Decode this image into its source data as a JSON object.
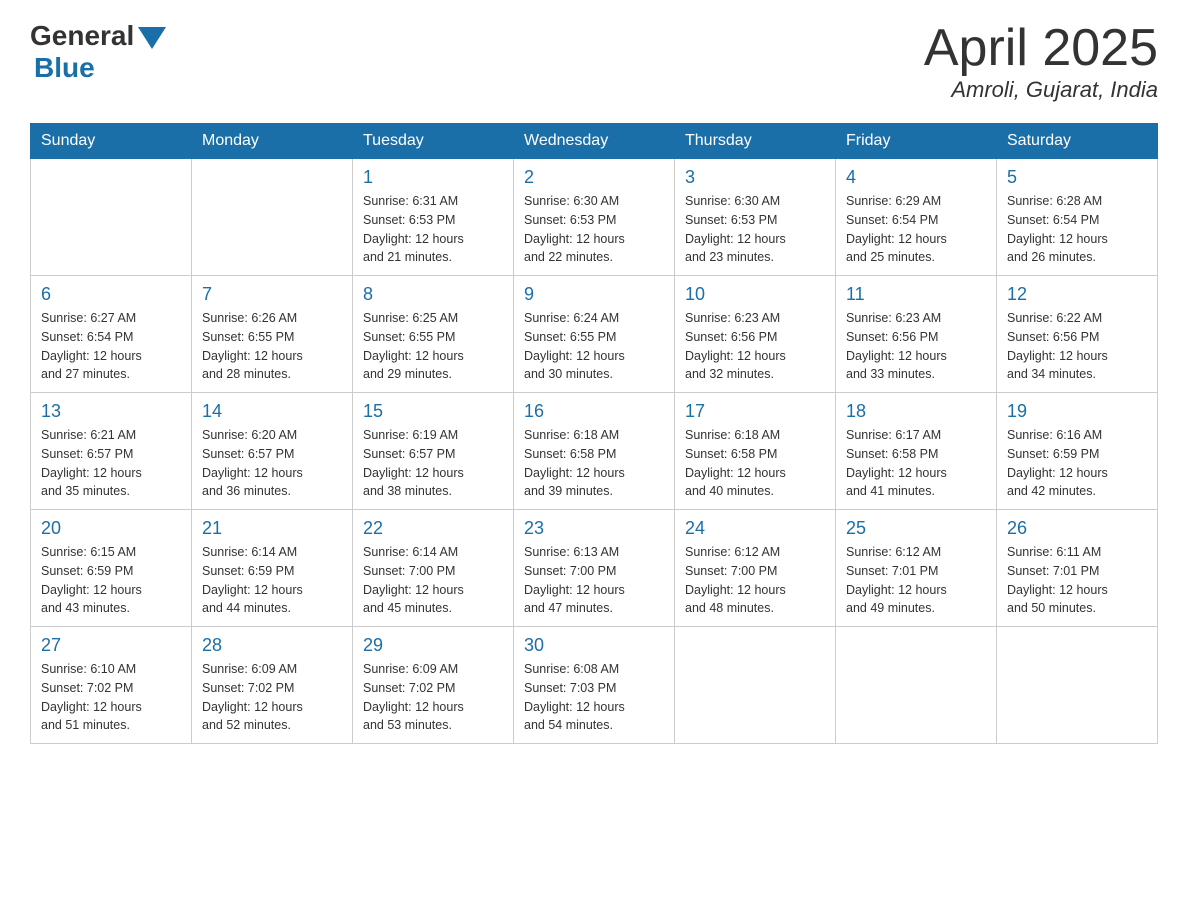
{
  "logo": {
    "general": "General",
    "blue": "Blue"
  },
  "title": "April 2025",
  "location": "Amroli, Gujarat, India",
  "days_of_week": [
    "Sunday",
    "Monday",
    "Tuesday",
    "Wednesday",
    "Thursday",
    "Friday",
    "Saturday"
  ],
  "weeks": [
    [
      {
        "day": "",
        "info": ""
      },
      {
        "day": "",
        "info": ""
      },
      {
        "day": "1",
        "info": "Sunrise: 6:31 AM\nSunset: 6:53 PM\nDaylight: 12 hours\nand 21 minutes."
      },
      {
        "day": "2",
        "info": "Sunrise: 6:30 AM\nSunset: 6:53 PM\nDaylight: 12 hours\nand 22 minutes."
      },
      {
        "day": "3",
        "info": "Sunrise: 6:30 AM\nSunset: 6:53 PM\nDaylight: 12 hours\nand 23 minutes."
      },
      {
        "day": "4",
        "info": "Sunrise: 6:29 AM\nSunset: 6:54 PM\nDaylight: 12 hours\nand 25 minutes."
      },
      {
        "day": "5",
        "info": "Sunrise: 6:28 AM\nSunset: 6:54 PM\nDaylight: 12 hours\nand 26 minutes."
      }
    ],
    [
      {
        "day": "6",
        "info": "Sunrise: 6:27 AM\nSunset: 6:54 PM\nDaylight: 12 hours\nand 27 minutes."
      },
      {
        "day": "7",
        "info": "Sunrise: 6:26 AM\nSunset: 6:55 PM\nDaylight: 12 hours\nand 28 minutes."
      },
      {
        "day": "8",
        "info": "Sunrise: 6:25 AM\nSunset: 6:55 PM\nDaylight: 12 hours\nand 29 minutes."
      },
      {
        "day": "9",
        "info": "Sunrise: 6:24 AM\nSunset: 6:55 PM\nDaylight: 12 hours\nand 30 minutes."
      },
      {
        "day": "10",
        "info": "Sunrise: 6:23 AM\nSunset: 6:56 PM\nDaylight: 12 hours\nand 32 minutes."
      },
      {
        "day": "11",
        "info": "Sunrise: 6:23 AM\nSunset: 6:56 PM\nDaylight: 12 hours\nand 33 minutes."
      },
      {
        "day": "12",
        "info": "Sunrise: 6:22 AM\nSunset: 6:56 PM\nDaylight: 12 hours\nand 34 minutes."
      }
    ],
    [
      {
        "day": "13",
        "info": "Sunrise: 6:21 AM\nSunset: 6:57 PM\nDaylight: 12 hours\nand 35 minutes."
      },
      {
        "day": "14",
        "info": "Sunrise: 6:20 AM\nSunset: 6:57 PM\nDaylight: 12 hours\nand 36 minutes."
      },
      {
        "day": "15",
        "info": "Sunrise: 6:19 AM\nSunset: 6:57 PM\nDaylight: 12 hours\nand 38 minutes."
      },
      {
        "day": "16",
        "info": "Sunrise: 6:18 AM\nSunset: 6:58 PM\nDaylight: 12 hours\nand 39 minutes."
      },
      {
        "day": "17",
        "info": "Sunrise: 6:18 AM\nSunset: 6:58 PM\nDaylight: 12 hours\nand 40 minutes."
      },
      {
        "day": "18",
        "info": "Sunrise: 6:17 AM\nSunset: 6:58 PM\nDaylight: 12 hours\nand 41 minutes."
      },
      {
        "day": "19",
        "info": "Sunrise: 6:16 AM\nSunset: 6:59 PM\nDaylight: 12 hours\nand 42 minutes."
      }
    ],
    [
      {
        "day": "20",
        "info": "Sunrise: 6:15 AM\nSunset: 6:59 PM\nDaylight: 12 hours\nand 43 minutes."
      },
      {
        "day": "21",
        "info": "Sunrise: 6:14 AM\nSunset: 6:59 PM\nDaylight: 12 hours\nand 44 minutes."
      },
      {
        "day": "22",
        "info": "Sunrise: 6:14 AM\nSunset: 7:00 PM\nDaylight: 12 hours\nand 45 minutes."
      },
      {
        "day": "23",
        "info": "Sunrise: 6:13 AM\nSunset: 7:00 PM\nDaylight: 12 hours\nand 47 minutes."
      },
      {
        "day": "24",
        "info": "Sunrise: 6:12 AM\nSunset: 7:00 PM\nDaylight: 12 hours\nand 48 minutes."
      },
      {
        "day": "25",
        "info": "Sunrise: 6:12 AM\nSunset: 7:01 PM\nDaylight: 12 hours\nand 49 minutes."
      },
      {
        "day": "26",
        "info": "Sunrise: 6:11 AM\nSunset: 7:01 PM\nDaylight: 12 hours\nand 50 minutes."
      }
    ],
    [
      {
        "day": "27",
        "info": "Sunrise: 6:10 AM\nSunset: 7:02 PM\nDaylight: 12 hours\nand 51 minutes."
      },
      {
        "day": "28",
        "info": "Sunrise: 6:09 AM\nSunset: 7:02 PM\nDaylight: 12 hours\nand 52 minutes."
      },
      {
        "day": "29",
        "info": "Sunrise: 6:09 AM\nSunset: 7:02 PM\nDaylight: 12 hours\nand 53 minutes."
      },
      {
        "day": "30",
        "info": "Sunrise: 6:08 AM\nSunset: 7:03 PM\nDaylight: 12 hours\nand 54 minutes."
      },
      {
        "day": "",
        "info": ""
      },
      {
        "day": "",
        "info": ""
      },
      {
        "day": "",
        "info": ""
      }
    ]
  ]
}
